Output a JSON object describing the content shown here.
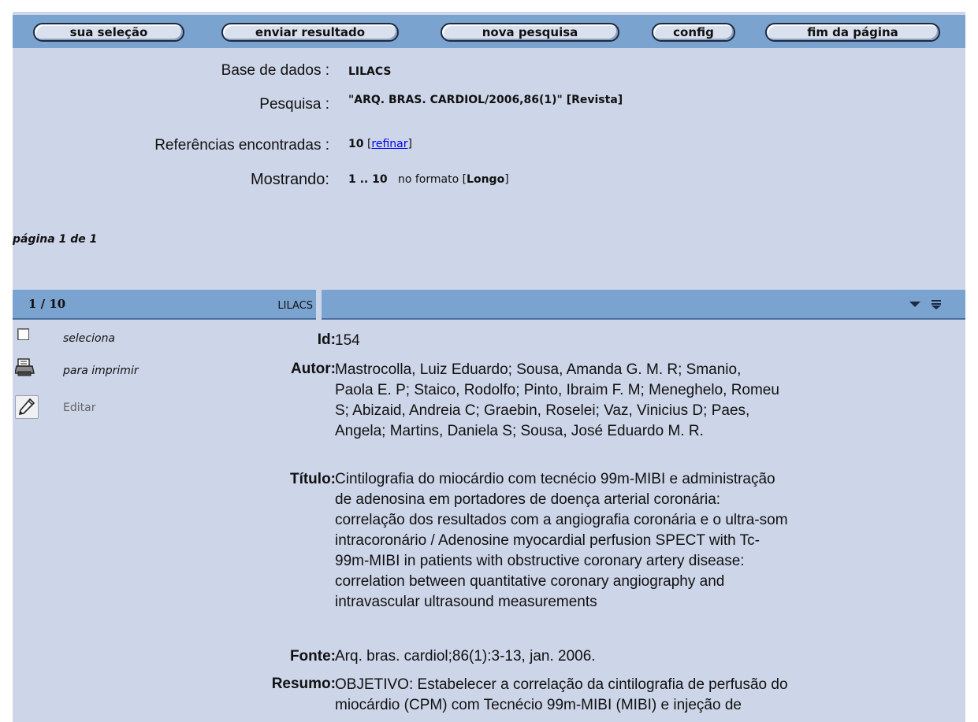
{
  "toolbar": {
    "sua_selecao": "sua seleção",
    "enviar_resultado": "enviar resultado",
    "nova_pesquisa": "nova pesquisa",
    "config": "config",
    "fim_da_pagina": "fim da página"
  },
  "info": {
    "base_label": "Base de dados :",
    "base_value": "LILACS",
    "pesquisa_label": "Pesquisa :",
    "pesquisa_value": "\"ARQ. BRAS. CARDIOL/2006,86(1)\"",
    "pesquisa_type": "[Revista]",
    "refs_label": "Referências encontradas :",
    "refs_count": "10",
    "refinar_open": "[",
    "refinar": "refinar",
    "refinar_close": "]",
    "mostrando_label": "Mostrando:",
    "mostrando_range": "1 .. 10",
    "formato_text": "no formato [",
    "formato_value": "Longo",
    "formato_close": "]"
  },
  "pagination": {
    "text": "página 1 de 1"
  },
  "record": {
    "count": "1 / 10",
    "database": "LILACS",
    "actions": {
      "seleciona": "seleciona",
      "imprimir": "para imprimir",
      "editar": "Editar"
    },
    "fields": {
      "id_label": "Id:",
      "id_value": "154",
      "autor_label": "Autor:",
      "autor_value": "Mastrocolla, Luiz Eduardo; Sousa, Amanda G. M. R; Smanio,\nPaola E. P; Staico, Rodolfo; Pinto, Ibraim F. M; Meneghelo, Romeu\nS; Abizaid, Andreia C; Graebin, Roselei; Vaz, Vinicius D; Paes,\nAngela; Martins, Daniela S; Sousa, José Eduardo M. R.",
      "titulo_label": "Título:",
      "titulo_value": "Cintilografia do miocárdio com tecnécio 99m-MIBI e administração\nde adenosina em portadores de doença arterial coronária:\ncorrelação dos resultados com a angiografia coronária e o ultra-som\nintracoronário / Adenosine myocardial perfusion SPECT with Tc-\n99m-MIBI in patients with obstructive coronary artery disease:\ncorrelation between quantitative coronary angiography and\nintravascular ultrasound measurements",
      "fonte_label": "Fonte:",
      "fonte_value": "Arq. bras. cardiol;86(1):3-13, jan. 2006.",
      "resumo_label": "Resumo:",
      "resumo_value": "OBJETIVO: Estabelecer a correlação da cintilografia de perfusão do\nmiocárdio (CPM) com Tecnécio 99m-MIBI (MIBI) e injeção de"
    }
  },
  "icons": {
    "expand": "triangle-down-icon",
    "collapse": "double-bar-down-icon",
    "print": "printer-icon",
    "edit": "pencil-icon"
  },
  "colors": {
    "background": "#cdd5e8",
    "bar": "#7ba3cf",
    "link": "#0000ee"
  }
}
